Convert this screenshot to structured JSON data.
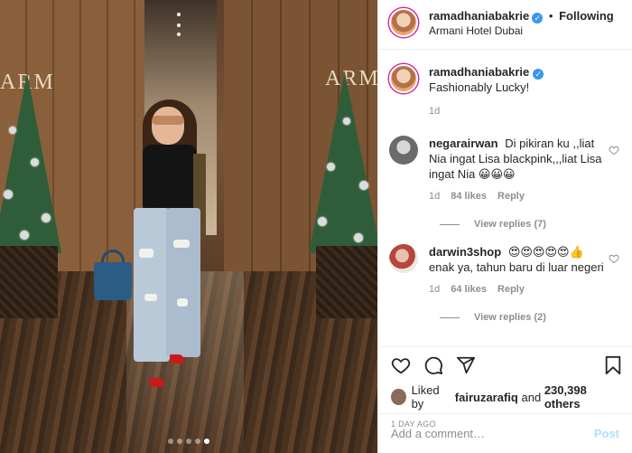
{
  "photo": {
    "logo_left": "ARM",
    "logo_right": "ARM",
    "carousel_dots": 5,
    "carousel_active_index": 4
  },
  "header": {
    "username": "ramadhaniabakrie",
    "separator": "•",
    "follow_status": "Following",
    "location": "Armani Hotel Dubai",
    "verified": true
  },
  "caption": {
    "username": "ramadhaniabakrie",
    "text": "Fashionably Lucky!",
    "time": "1d"
  },
  "comments": [
    {
      "username": "negarairwan",
      "text": "Di pikiran ku ,,liat Nia ingat Lisa blackpink,,,liat Lisa ingat Nia 😀😀😀",
      "time": "1d",
      "likes": "84 likes",
      "reply": "Reply",
      "view_replies": "View replies (7)"
    },
    {
      "username": "darwin3shop",
      "text": "😍😍😍😍😍👍 enak ya, tahun baru di luar negeri",
      "time": "1d",
      "likes": "64 likes",
      "reply": "Reply",
      "view_replies": "View replies (2)"
    }
  ],
  "icons": [
    "heart-icon",
    "comment-icon",
    "share-icon",
    "bookmark-icon"
  ],
  "likes": {
    "prefix": "Liked by",
    "user": "fairuzarafiq",
    "joiner": "and",
    "others": "230,398 others"
  },
  "timestamp": "1 DAY AGO",
  "add_comment": {
    "placeholder": "Add a comment…",
    "post_label": "Post"
  },
  "colors": {
    "link_blue": "#3897f0",
    "post_disabled": "#b2dffc",
    "muted": "#8e8e8e"
  }
}
